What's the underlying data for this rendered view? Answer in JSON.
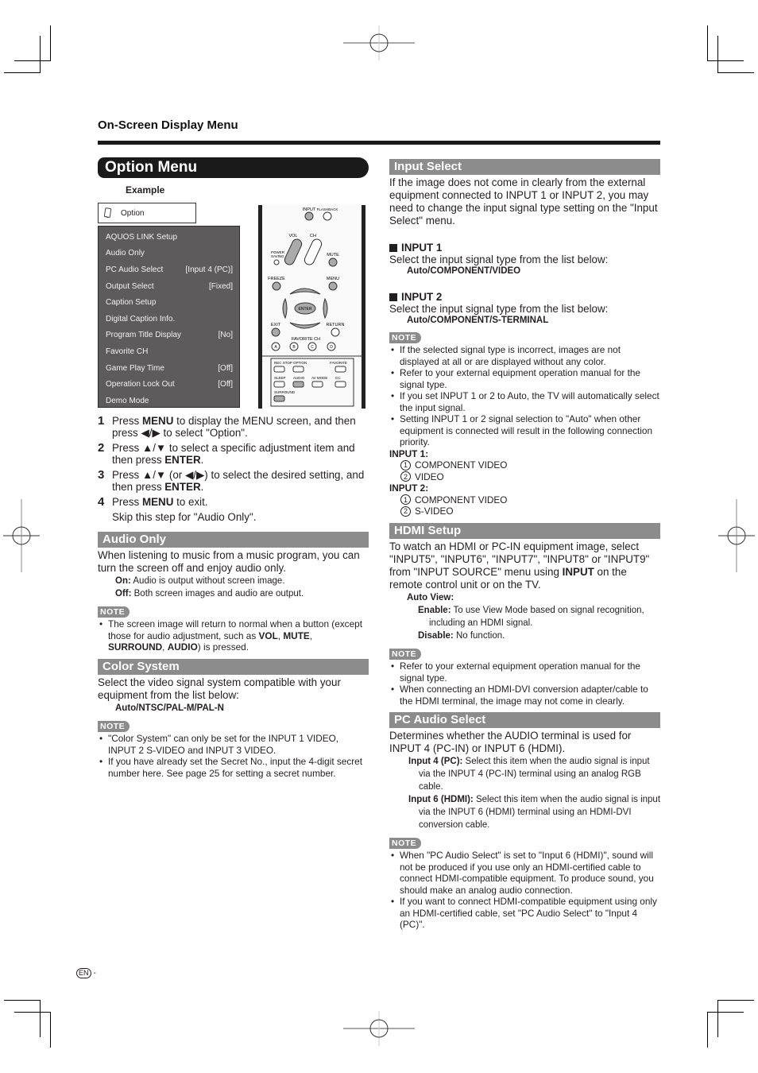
{
  "running_head": "On-Screen Display Menu",
  "option_menu": {
    "title": "Option Menu",
    "example_label": "Example",
    "osd_title": "Option",
    "osd_icon": "remote-card-icon",
    "osd_items": [
      {
        "label": "AQUOS LINK Setup",
        "value": ""
      },
      {
        "label": "Audio Only",
        "value": ""
      },
      {
        "label": "PC Audio Select",
        "value": "[Input 4 (PC)]"
      },
      {
        "label": "Output Select",
        "value": "[Fixed]"
      },
      {
        "label": "Caption Setup",
        "value": ""
      },
      {
        "label": "Digital Caption Info.",
        "value": ""
      },
      {
        "label": "Program Title Display",
        "value": "[No]"
      },
      {
        "label": "Favorite CH",
        "value": ""
      },
      {
        "label": "Game Play Time",
        "value": "[Off]"
      },
      {
        "label": "Operation Lock Out",
        "value": "[Off]"
      },
      {
        "label": "Demo Mode",
        "value": ""
      }
    ],
    "remote_labels": {
      "input": "INPUT",
      "flashback": "FLASHBACK",
      "vol": "VOL",
      "ch": "CH",
      "power_saving_1": "POWER",
      "power_saving_2": "SAVING",
      "mute": "MUTE",
      "freeze": "FREEZE",
      "menu": "MENU",
      "enter": "ENTER",
      "exit": "EXIT",
      "return": "RETURN",
      "favorite_ch": "FAVORITE CH",
      "a": "A",
      "b": "B",
      "c": "C",
      "d": "D",
      "rec_stop": "REC STOP",
      "option": "OPTION",
      "favorite": "FAVORITE",
      "sleep": "SLEEP",
      "audio": "AUDIO",
      "av_mode": "AV MODE",
      "cc": "CC",
      "surround": "SURROUND"
    },
    "steps": [
      {
        "num": "1",
        "parts": [
          {
            "t": "Press "
          },
          {
            "b": "MENU"
          },
          {
            "t": " to display the MENU screen, and then press ◀/▶ to select \"Option\"."
          }
        ]
      },
      {
        "num": "2",
        "parts": [
          {
            "t": "Press ▲/▼ to select a specific adjustment item and then press "
          },
          {
            "b": "ENTER"
          },
          {
            "t": "."
          }
        ]
      },
      {
        "num": "3",
        "parts": [
          {
            "t": "Press ▲/▼ (or ◀/▶) to select the desired setting, and then press "
          },
          {
            "b": "ENTER"
          },
          {
            "t": "."
          }
        ]
      },
      {
        "num": "4",
        "parts": [
          {
            "t": "Press "
          },
          {
            "b": "MENU"
          },
          {
            "t": " to exit."
          }
        ]
      }
    ],
    "step4_sub": "Skip this step for \"Audio Only\"."
  },
  "audio_only": {
    "title": "Audio Only",
    "body": "When listening to music from a music program, you can turn the screen off and enjoy audio only.",
    "on_label": "On:",
    "on_text": " Audio is output without screen image.",
    "off_label": "Off:",
    "off_text": " Both screen images and audio are output.",
    "note_label": "NOTE",
    "note_parts": [
      {
        "t": "The screen image will return to normal when a button (except those for audio adjustment, such as "
      },
      {
        "b": "VOL"
      },
      {
        "t": ", "
      },
      {
        "b": "MUTE"
      },
      {
        "t": ", "
      },
      {
        "b": "SURROUND"
      },
      {
        "t": ", "
      },
      {
        "b": "AUDIO"
      },
      {
        "t": ") is pressed."
      }
    ]
  },
  "color_system": {
    "title": "Color System",
    "body": "Select the video signal system compatible with your equipment from the list below:",
    "options": "Auto/NTSC/PAL-M/PAL-N",
    "note_label": "NOTE",
    "notes": [
      "\"Color System\" can only be set for the INPUT 1 VIDEO, INPUT 2 S-VIDEO and INPUT 3 VIDEO.",
      "If you have already set the Secret No., input the 4-digit secret number here. See page 25 for setting a secret number."
    ]
  },
  "input_select": {
    "title": "Input Select",
    "body": "If the image does not come in clearly from the external equipment connected to INPUT 1 or INPUT 2, you may need to change the input signal type setting on the \"Input Select\" menu.",
    "input1_title": "INPUT 1",
    "input1_body": "Select the input signal type from the list below:",
    "input1_options": "Auto/COMPONENT/VIDEO",
    "input2_title": "INPUT 2",
    "input2_body": "Select the input signal type from the list below:",
    "input2_options": "Auto/COMPONENT/S-TERMINAL",
    "note_label": "NOTE",
    "notes": [
      "If the selected signal type is incorrect, images are not displayed at all or are displayed without any color.",
      "Refer to your external equipment operation manual for the signal type.",
      "If you set INPUT 1 or 2 to Auto, the TV will automatically select the input signal.",
      "Setting INPUT 1 or 2 signal selection to \"Auto\" when other equipment is connected will result in the following connection priority."
    ],
    "priority": [
      {
        "head": "INPUT 1:",
        "items": [
          {
            "n": "1",
            "t": "COMPONENT VIDEO"
          },
          {
            "n": "2",
            "t": "VIDEO"
          }
        ]
      },
      {
        "head": "INPUT 2:",
        "items": [
          {
            "n": "1",
            "t": "COMPONENT VIDEO"
          },
          {
            "n": "2",
            "t": "S-VIDEO"
          }
        ]
      }
    ]
  },
  "hdmi_setup": {
    "title": "HDMI Setup",
    "body_parts": [
      {
        "t": "To watch an HDMI or PC-IN equipment image, select \"INPUT5\", \"INPUT6\", \"INPUT7\", \"INPUT8\" or \"INPUT9\" from \"INPUT SOURCE\" menu using "
      },
      {
        "b": "INPUT"
      },
      {
        "t": " on the remote control unit or on the TV."
      }
    ],
    "auto_view_label": "Auto View:",
    "enable_label": "Enable:",
    "enable_text": " To use View Mode based on signal recognition, including an HDMI signal.",
    "disable_label": "Disable:",
    "disable_text": " No function.",
    "note_label": "NOTE",
    "notes": [
      "Refer to your external equipment operation manual for the signal type.",
      "When connecting an HDMI-DVI conversion adapter/cable to the HDMI terminal, the image may not come in clearly."
    ]
  },
  "pc_audio_select": {
    "title": "PC Audio Select",
    "body": "Determines whether the AUDIO terminal is used for INPUT 4 (PC-IN) or INPUT 6 (HDMI).",
    "opt1_label": "Input 4 (PC):",
    "opt1_text": " Select this item when the audio signal is input via the INPUT 4 (PC-IN) terminal using an analog RGB cable.",
    "opt2_label": "Input 6 (HDMI):",
    "opt2_text": " Select this item when the audio signal is input via the INPUT 6 (HDMI) terminal using an HDMI-DVI conversion cable.",
    "note_label": "NOTE",
    "notes": [
      "When \"PC Audio Select\" is set to \"Input 6 (HDMI)\", sound will not be produced if you use only an HDMI-certified cable to connect HDMI-compatible equipment. To produce sound, you should make an analog audio connection.",
      "If you want to connect HDMI-compatible equipment using only an HDMI-certified cable, set \"PC Audio Select\" to \"Input 4 (PC)\"."
    ]
  },
  "footer": {
    "lang_badge": "EN",
    "page_suffix": "-"
  }
}
